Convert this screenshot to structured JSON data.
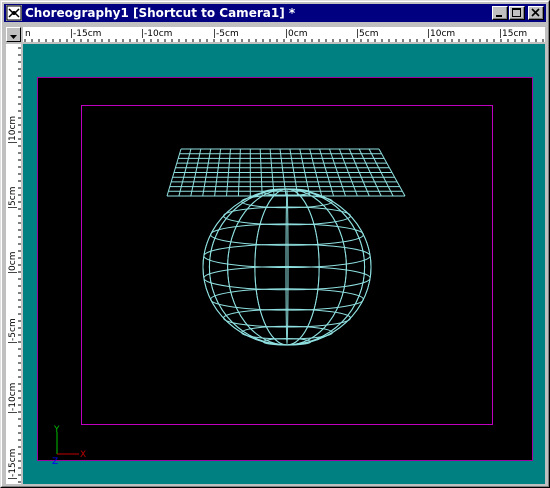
{
  "window": {
    "title": "Choreography1 [Shortcut to Camera1] *",
    "buttons": {
      "minimize": "minimize",
      "maximize": "maximize",
      "close": "close"
    }
  },
  "rulers": {
    "horizontal": [
      "n",
      "|-15cm",
      "|-10cm",
      "|-5cm",
      "|0cm",
      "|5cm",
      "|10cm",
      "|15cm"
    ],
    "vertical": [
      "|10cm",
      "|5cm",
      "|0cm",
      "|-5cm",
      "|-10cm",
      "|-15cm"
    ]
  },
  "viewport": {
    "axes": {
      "y": "Y",
      "x": "X",
      "z": "Z"
    },
    "colors": {
      "background": "#008080",
      "viewport": "#000000",
      "frame": "#c000c0",
      "wireframe": "#8fe0e0",
      "axis_y": "#00c000",
      "axis_x": "#c00000",
      "axis_z": "#0000ff"
    },
    "objects": [
      "wireframe-plane",
      "wireframe-sphere"
    ]
  }
}
